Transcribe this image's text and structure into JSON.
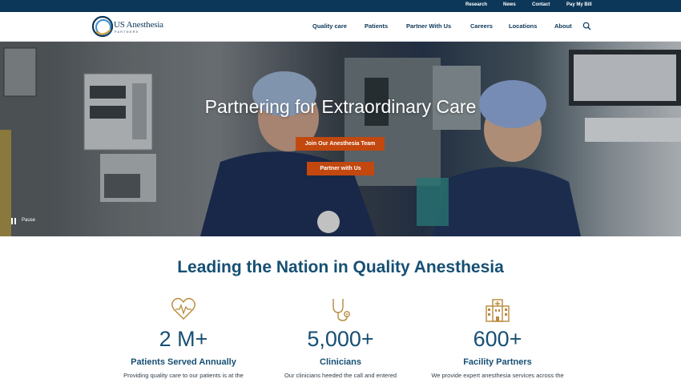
{
  "utility_nav": [
    "Research",
    "News",
    "Contact",
    "Pay My Bill"
  ],
  "brand": {
    "name": "US Anesthesia",
    "tagline": "PARTNERS"
  },
  "main_nav": [
    "Quality care",
    "Patients",
    "Partner With Us",
    "Careers",
    "Locations",
    "About"
  ],
  "hero": {
    "title": "Partnering for Extraordinary Care",
    "primary_button": "Join Our Anesthesia Team",
    "secondary_button": "Partner with Us",
    "pause_label": "Pause"
  },
  "stats_section": {
    "title": "Leading the Nation in Quality Anesthesia",
    "stats": [
      {
        "icon": "heart-pulse-icon",
        "value": "2 M+",
        "label": "Patients Served Annually",
        "desc": "Providing quality care to our patients is at the"
      },
      {
        "icon": "stethoscope-icon",
        "value": "5,000+",
        "label": "Clinicians",
        "desc": "Our clinicians heeded the call and entered"
      },
      {
        "icon": "hospital-icon",
        "value": "600+",
        "label": "Facility Partners",
        "desc": "We provide expert anesthesia services across the"
      }
    ]
  },
  "colors": {
    "navy": "#0c3758",
    "accent_orange": "#c2480f",
    "gold_icon": "#b8893a",
    "heading_blue": "#164f73"
  }
}
